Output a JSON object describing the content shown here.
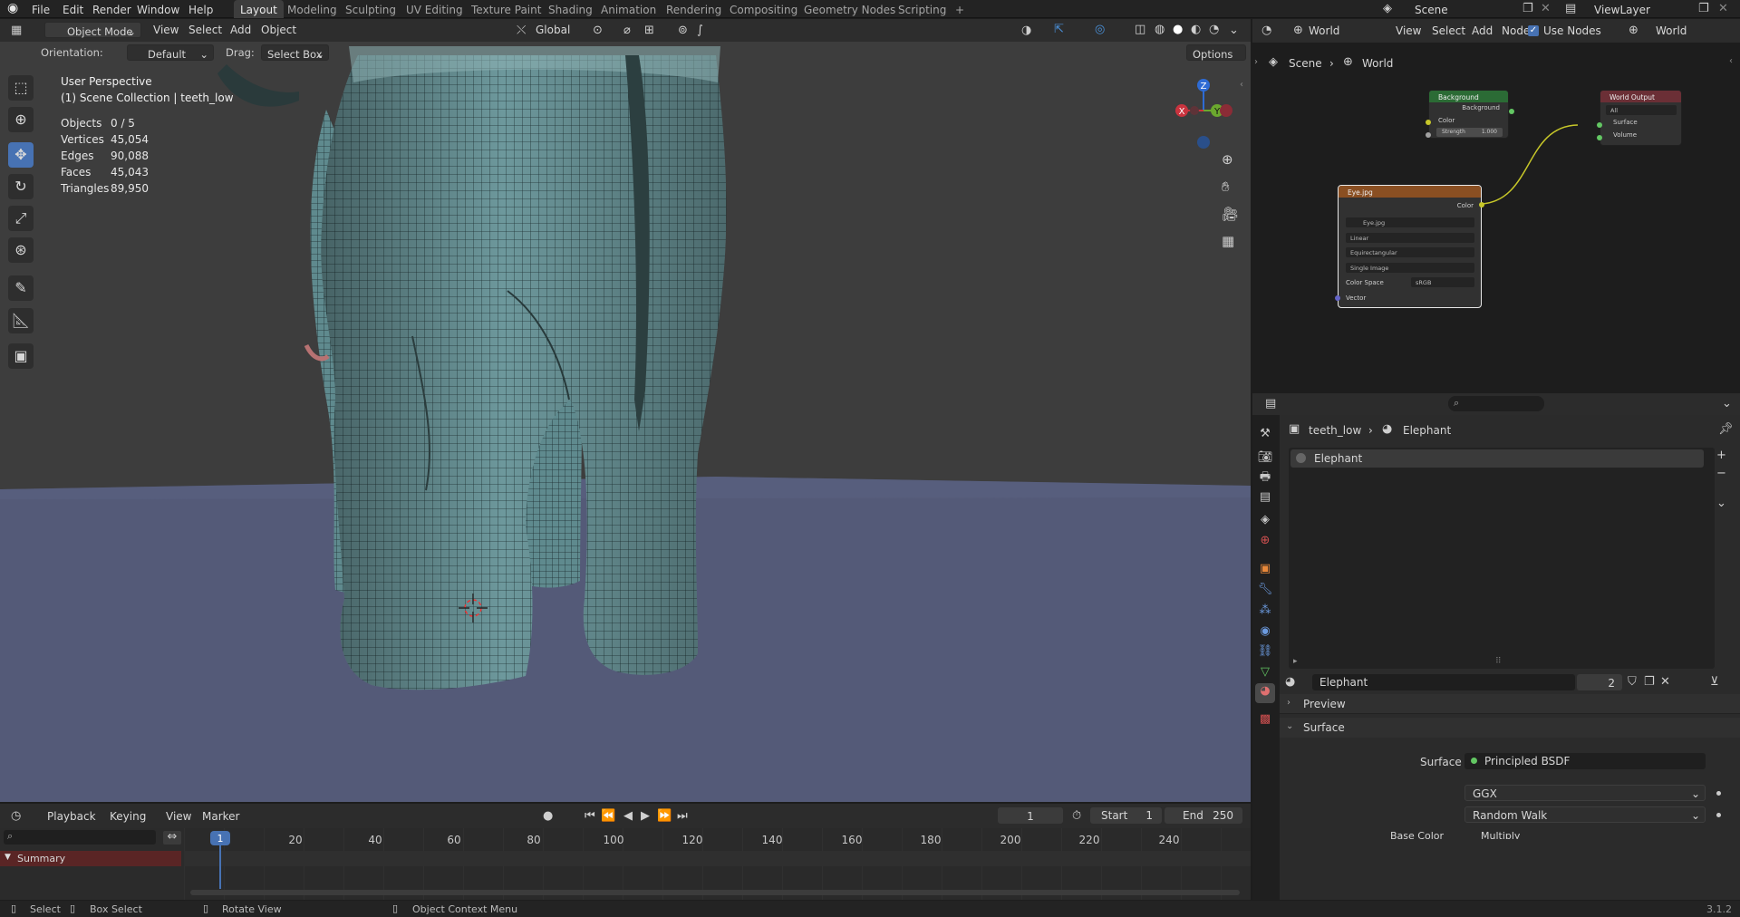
{
  "topbar": {
    "menus": [
      "File",
      "Edit",
      "Render",
      "Window",
      "Help"
    ],
    "workspaces": [
      "Layout",
      "Modeling",
      "Sculpting",
      "UV Editing",
      "Texture Paint",
      "Shading",
      "Animation",
      "Rendering",
      "Compositing",
      "Geometry Nodes",
      "Scripting"
    ],
    "active_workspace": "Layout",
    "add_tab": "+",
    "scene_label": "Scene",
    "viewlayer_label": "ViewLayer"
  },
  "viewport": {
    "mode": "Object Mode",
    "menus": [
      "View",
      "Select",
      "Add",
      "Object"
    ],
    "transform_orientation": "Global",
    "orientation_label": "Orientation:",
    "orientation_value": "Default",
    "drag_label": "Drag:",
    "drag_value": "Select Box",
    "options_label": "Options",
    "perspective": "User Perspective",
    "collection": "(1) Scene Collection | teeth_low",
    "stats": [
      {
        "label": "Objects",
        "value": "0 / 5"
      },
      {
        "label": "Vertices",
        "value": "45,054"
      },
      {
        "label": "Edges",
        "value": "90,088"
      },
      {
        "label": "Faces",
        "value": "45,043"
      },
      {
        "label": "Triangles",
        "value": "89,950"
      }
    ],
    "gizmo": {
      "x": "X",
      "y": "Y",
      "z": "Z"
    }
  },
  "node_editor": {
    "world_label": "World",
    "menus": [
      "View",
      "Select",
      "Add",
      "Node"
    ],
    "use_nodes_label": "Use Nodes",
    "world_right": "World",
    "breadcrumb_scene": "Scene",
    "breadcrumb_world": "World",
    "background_node": {
      "title": "Background",
      "out": "Background",
      "color": "Color",
      "strength": "Strength",
      "strength_value": "1.000"
    },
    "image_node": {
      "title": "Eye.jpg",
      "out": "Color",
      "file": "Eye.jpg",
      "interp": "Linear",
      "proj": "Equirectangular",
      "source": "Single Image",
      "colorspace_label": "Color Space",
      "colorspace_value": "sRGB",
      "vector": "Vector"
    },
    "output_node": {
      "title": "World Output",
      "target": "All",
      "surface": "Surface",
      "volume": "Volume"
    }
  },
  "properties": {
    "breadcrumb_object": "teeth_low",
    "breadcrumb_material": "Elephant",
    "slot": "Elephant",
    "material_name": "Elephant",
    "users": "2",
    "preview_label": "Preview",
    "surface_panel": "Surface",
    "surface_label": "Surface",
    "surface_value": "Principled BSDF",
    "distribution": "GGX",
    "subsurface": "Random Walk",
    "partial_label": "Base Color",
    "partial_value": "Multiply"
  },
  "timeline": {
    "menus": [
      "Playback",
      "Keying",
      "View",
      "Marker"
    ],
    "current_frame": "1",
    "start_label": "Start",
    "start_value": "1",
    "end_label": "End",
    "end_value": "250",
    "ruler": [
      "20",
      "40",
      "60",
      "80",
      "100",
      "120",
      "140",
      "160",
      "180",
      "200",
      "220",
      "240"
    ],
    "playhead": "1",
    "summary": "Summary"
  },
  "statusbar": {
    "select": "Select",
    "box_select": "Box Select",
    "rotate_view": "Rotate View",
    "context_menu": "Object Context Menu",
    "version": "3.1.2"
  },
  "colors": {
    "accent": "#4772b3",
    "viewport_bg": "#3d3d3d",
    "ground": "#545a78",
    "mesh": "#6a9498",
    "selection": "#f5a020"
  }
}
